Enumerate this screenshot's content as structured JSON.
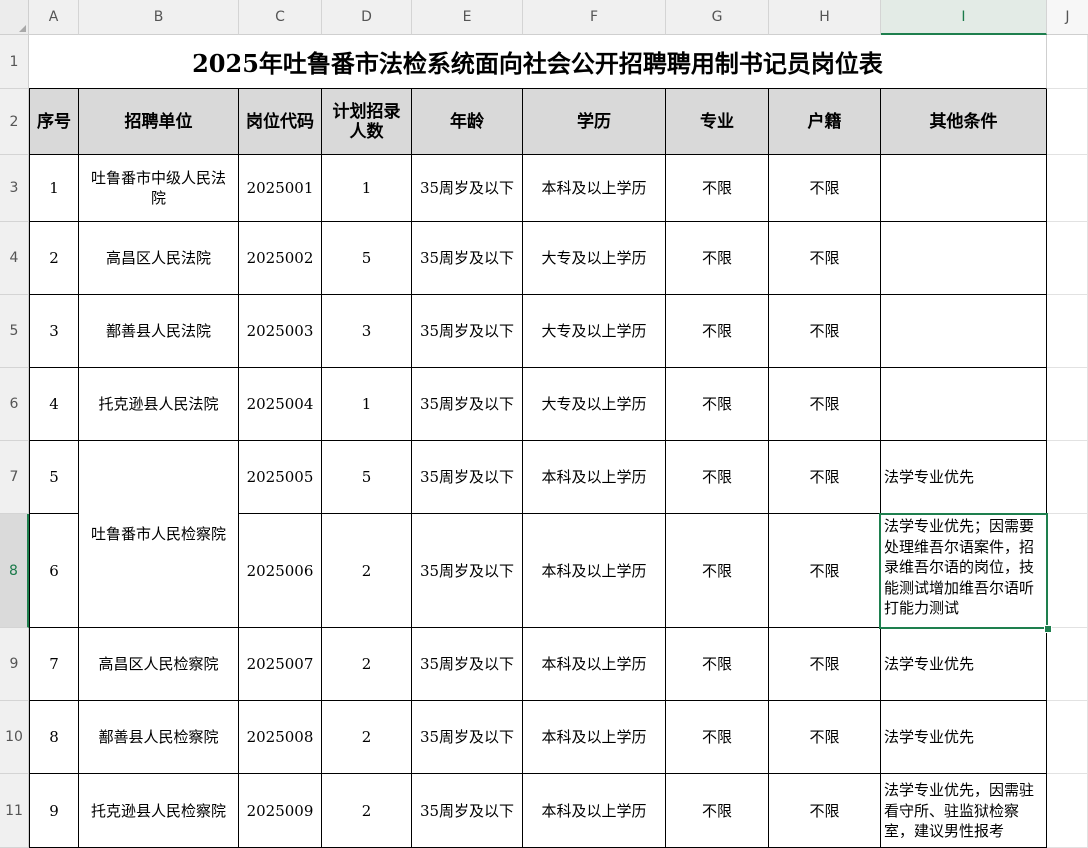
{
  "spreadsheet": {
    "columns": [
      "A",
      "B",
      "C",
      "D",
      "E",
      "F",
      "G",
      "H",
      "I",
      "J"
    ],
    "rows": [
      "1",
      "2",
      "3",
      "4",
      "5",
      "6",
      "7",
      "8",
      "9",
      "10",
      "11"
    ],
    "selected_cell": {
      "column": "I",
      "row": "8"
    },
    "accent_color": "#1e7f4e",
    "title": "2025年吐鲁番市法检系统面向社会公开招聘聘用制书记员岗位表",
    "headers": {
      "seq": "序号",
      "unit": "招聘单位",
      "code": "岗位代码",
      "plan": "计划招录人数",
      "age": "年龄",
      "edu": "学历",
      "major": "专业",
      "huji": "户籍",
      "other": "其他条件"
    },
    "records": [
      {
        "seq": "1",
        "unit": "吐鲁番市中级人民法院",
        "code": "2025001",
        "plan": "1",
        "age": "35周岁及以下",
        "edu": "本科及以上学历",
        "major": "不限",
        "huji": "不限",
        "other": ""
      },
      {
        "seq": "2",
        "unit": "高昌区人民法院",
        "code": "2025002",
        "plan": "5",
        "age": "35周岁及以下",
        "edu": "大专及以上学历",
        "major": "不限",
        "huji": "不限",
        "other": ""
      },
      {
        "seq": "3",
        "unit": "鄯善县人民法院",
        "code": "2025003",
        "plan": "3",
        "age": "35周岁及以下",
        "edu": "大专及以上学历",
        "major": "不限",
        "huji": "不限",
        "other": ""
      },
      {
        "seq": "4",
        "unit": "托克逊县人民法院",
        "code": "2025004",
        "plan": "1",
        "age": "35周岁及以下",
        "edu": "大专及以上学历",
        "major": "不限",
        "huji": "不限",
        "other": ""
      },
      {
        "seq": "5",
        "unit": "吐鲁番市人民检察院",
        "code": "2025005",
        "plan": "5",
        "age": "35周岁及以下",
        "edu": "本科及以上学历",
        "major": "不限",
        "huji": "不限",
        "other": "法学专业优先"
      },
      {
        "seq": "6",
        "unit": "",
        "code": "2025006",
        "plan": "2",
        "age": "35周岁及以下",
        "edu": "本科及以上学历",
        "major": "不限",
        "huji": "不限",
        "other": "法学专业优先；因需要处理维吾尔语案件，招录维吾尔语的岗位，技能测试增加维吾尔语听打能力测试"
      },
      {
        "seq": "7",
        "unit": "高昌区人民检察院",
        "code": "2025007",
        "plan": "2",
        "age": "35周岁及以下",
        "edu": "本科及以上学历",
        "major": "不限",
        "huji": "不限",
        "other": "法学专业优先"
      },
      {
        "seq": "8",
        "unit": "鄯善县人民检察院",
        "code": "2025008",
        "plan": "2",
        "age": "35周岁及以下",
        "edu": "本科及以上学历",
        "major": "不限",
        "huji": "不限",
        "other": "法学专业优先"
      },
      {
        "seq": "9",
        "unit": "托克逊县人民检察院",
        "code": "2025009",
        "plan": "2",
        "age": "35周岁及以下",
        "edu": "本科及以上学历",
        "major": "不限",
        "huji": "不限",
        "other": "法学专业优先，因需驻看守所、驻监狱检察室，建议男性报考"
      }
    ]
  }
}
